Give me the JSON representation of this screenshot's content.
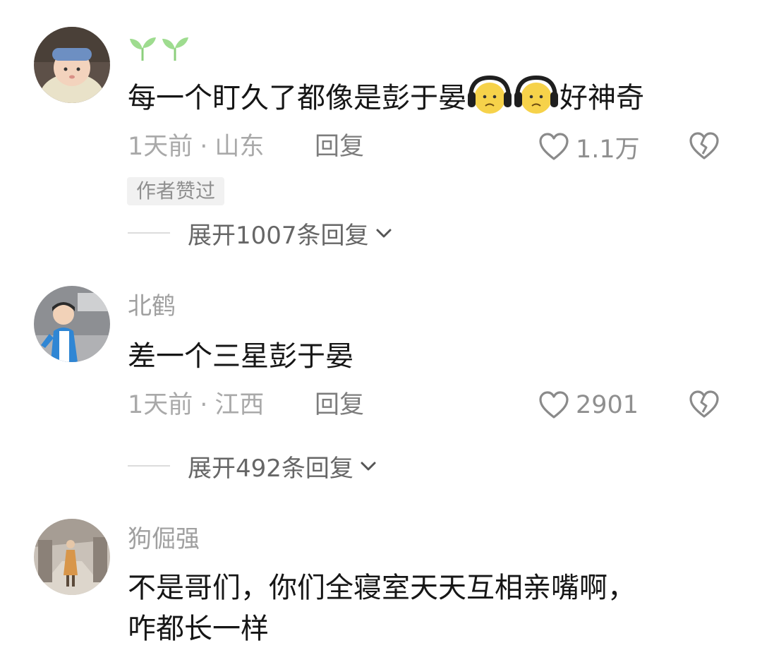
{
  "comments": [
    {
      "username": "🌱🌱",
      "content_before_emoji": "每一个盯久了都像是彭于晏",
      "content_after_emoji": "好神奇",
      "emoji_icon": "headphones-sad-face-icon",
      "time": "1天前",
      "location": "山东",
      "separator": "·",
      "reply_label": "回复",
      "likes": "1.1万",
      "author_badge": "作者赞过",
      "expand_label": "展开1007条回复"
    },
    {
      "username": "北鹤",
      "content": "差一个三星彭于晏",
      "time": "1天前",
      "location": "江西",
      "separator": "·",
      "reply_label": "回复",
      "likes": "2901",
      "expand_label": "展开492条回复"
    },
    {
      "username": "狗倔强",
      "content_line1": "不是哥们，你们全寝室天天互相亲嘴啊，",
      "content_line2": "咋都长一样"
    }
  ],
  "icons": {
    "like": "heart-outline-icon",
    "dislike": "broken-heart-icon",
    "expand": "chevron-down-icon"
  },
  "colors": {
    "text_primary": "#161616",
    "text_secondary": "#a9a9a9",
    "username": "#a0a0a0",
    "badge_bg": "#f1f1f1"
  }
}
